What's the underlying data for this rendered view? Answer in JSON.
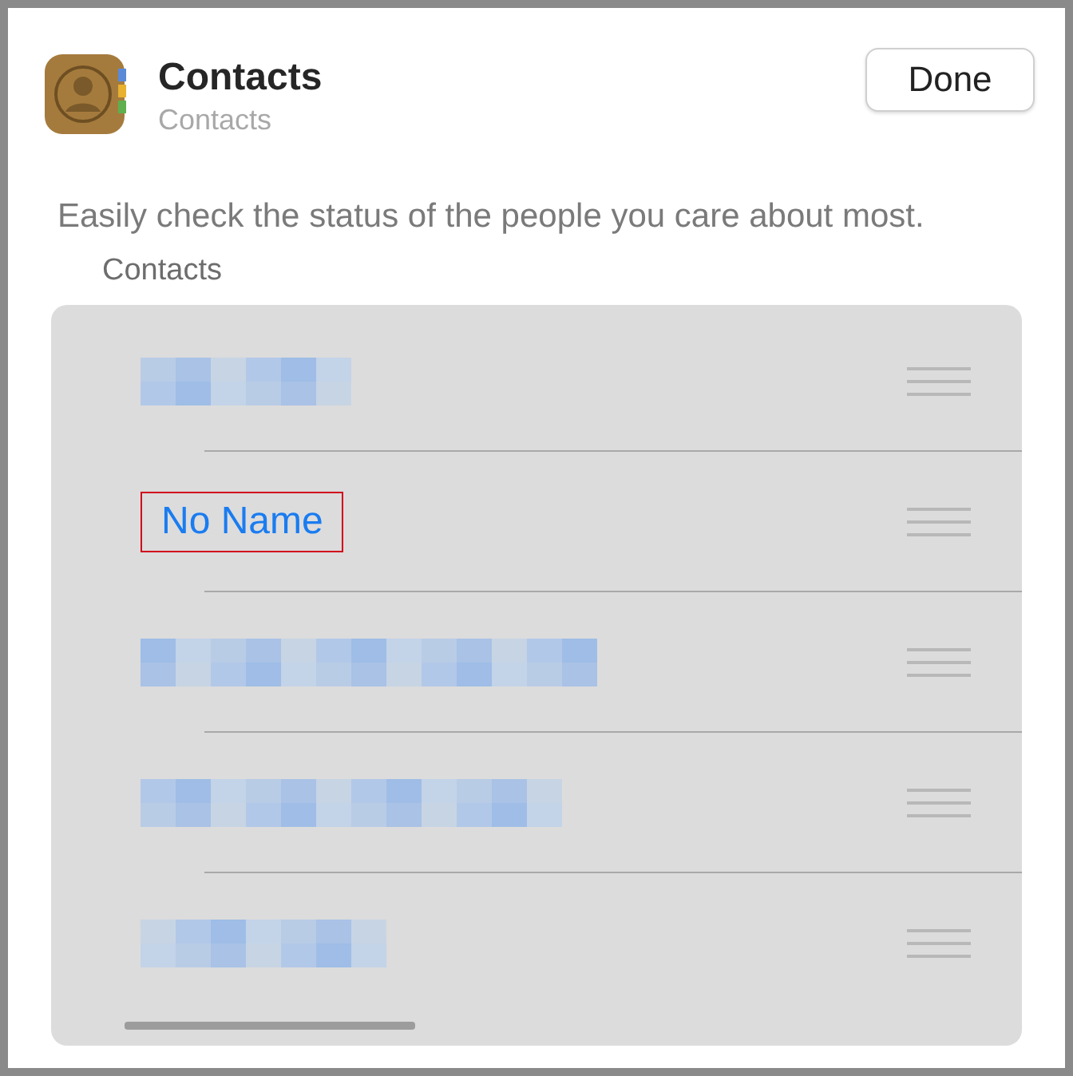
{
  "widget": {
    "title": "Contacts",
    "subtitle": "Contacts"
  },
  "done_button": "Done",
  "description": "Easily check the status of the people you care about most.",
  "section_label": "Contacts",
  "rows": [
    {
      "kind": "redacted"
    },
    {
      "kind": "name",
      "name": "No Name",
      "highlighted": true
    },
    {
      "kind": "redacted"
    },
    {
      "kind": "redacted"
    },
    {
      "kind": "redacted"
    }
  ]
}
